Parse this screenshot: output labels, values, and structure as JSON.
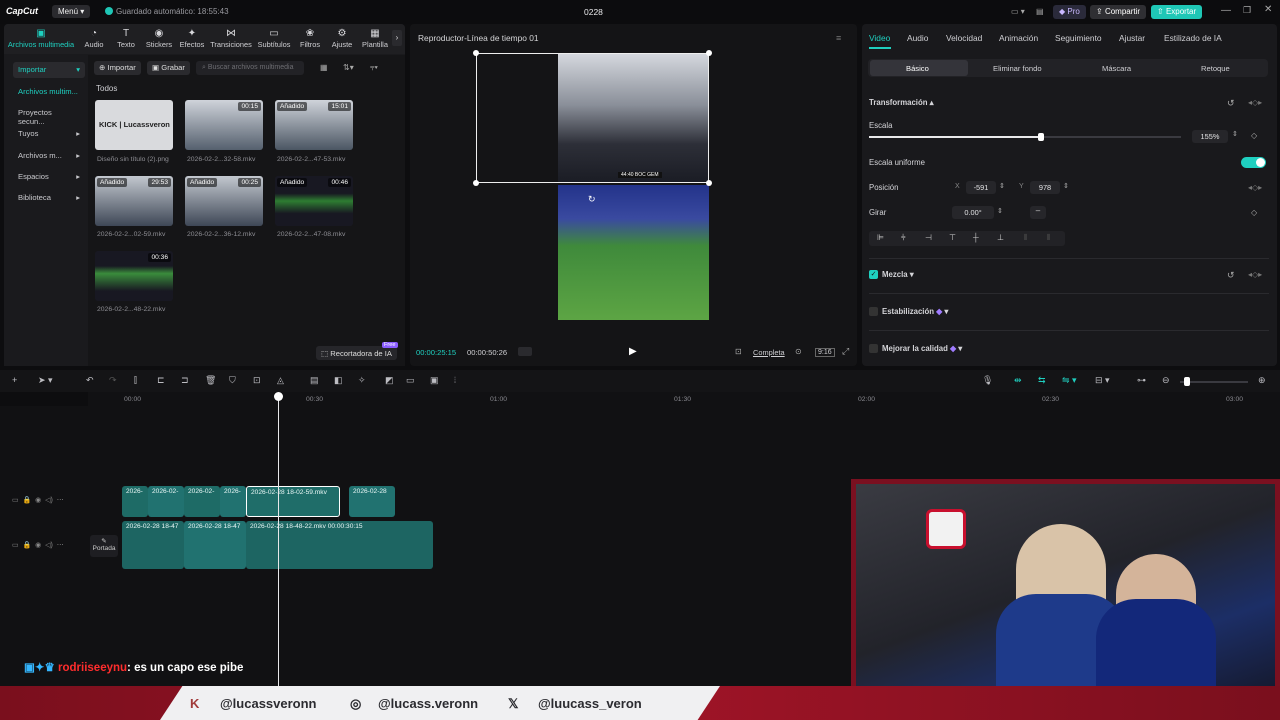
{
  "app": {
    "logo": "CapCut",
    "menu": "Menú",
    "autosave": "Guardado automático: 18:55:43",
    "project": "0228",
    "pro": "Pro",
    "share": "Compartir",
    "export": "Exportar"
  },
  "toolbar": {
    "items": [
      "Archivos multimedia",
      "Audio",
      "Texto",
      "Stickers",
      "Efectos",
      "Transiciones",
      "Subtítulos",
      "Filtros",
      "Ajuste",
      "Plantilla"
    ]
  },
  "media_side": {
    "items": [
      "Importar",
      "Archivos multim...",
      "Proyectos secun...",
      "Tuyos",
      "Archivos m...",
      "Espacios",
      "Biblioteca"
    ]
  },
  "media": {
    "import": "Importar",
    "record": "Grabar",
    "search_placeholder": "Buscar archivos multimedia",
    "all": "Todos",
    "thumbs": [
      {
        "label": "Diseño sin título (2).png",
        "badge": "",
        "dur": "",
        "logo": "KICK | Lucassveron"
      },
      {
        "label": "2026-02-2...32-58.mkv",
        "badge": "",
        "dur": "00:15"
      },
      {
        "label": "2026-02-2...47-53.mkv",
        "badge": "Añadido",
        "dur": "15:01"
      },
      {
        "label": "2026-02-2...02-59.mkv",
        "badge": "Añadido",
        "dur": "29:53"
      },
      {
        "label": "2026-02-2...36-12.mkv",
        "badge": "Añadido",
        "dur": "00:25"
      },
      {
        "label": "2026-02-2...47-08.mkv",
        "badge": "Añadido",
        "dur": "00:46"
      },
      {
        "label": "2026-02-2...48-22.mkv",
        "badge": "",
        "dur": "00:36"
      }
    ],
    "ai_cutout": "Recortadora de IA",
    "free": "Free"
  },
  "player": {
    "title": "Reproductor-Línea de tiempo 01",
    "current": "00:00:25:15",
    "total": "00:00:50:26",
    "fit": "Completa",
    "ratio": "9:16",
    "score": "44:40  BOC  GEM"
  },
  "props": {
    "tabs": [
      "Video",
      "Audio",
      "Velocidad",
      "Animación",
      "Seguimiento",
      "Ajustar",
      "Estilizado de IA"
    ],
    "subtabs": [
      "Básico",
      "Eliminar fondo",
      "Máscara",
      "Retoque"
    ],
    "transform": "Transformación",
    "scale_label": "Escala",
    "scale_value": "155%",
    "scale_level": 0.55,
    "uniform": "Escala uniforme",
    "position_label": "Posición",
    "pos_x_label": "X",
    "pos_x": "-591",
    "pos_y_label": "Y",
    "pos_y": "978",
    "rotate_label": "Girar",
    "rotate": "0.00°",
    "mix": "Mezcla",
    "stab": "Estabilización",
    "quality": "Mejorar la calidad"
  },
  "timeline": {
    "ticks": [
      "00:00",
      "00:30",
      "01:00",
      "01:30",
      "02:00",
      "02:30",
      "03:00"
    ],
    "track1": [
      "2026-",
      "2026-02-",
      "2026-02-",
      "2026-",
      "2026-02-28 18-02-59.mkv",
      "2026-02-28"
    ],
    "track2": [
      "2026-02-28 18-47",
      "2026-02-28 18-47",
      "2026-02-28 18-48-22.mkv  00:00:30:15"
    ],
    "cover": "Portada"
  },
  "overlay": {
    "chat_user": "rodriiseeynu",
    "chat_msg": ": es un capo ese pibe",
    "kick": "@lucassveronn",
    "instagram": "@lucass.veronn",
    "x": "@luucass_veron"
  }
}
